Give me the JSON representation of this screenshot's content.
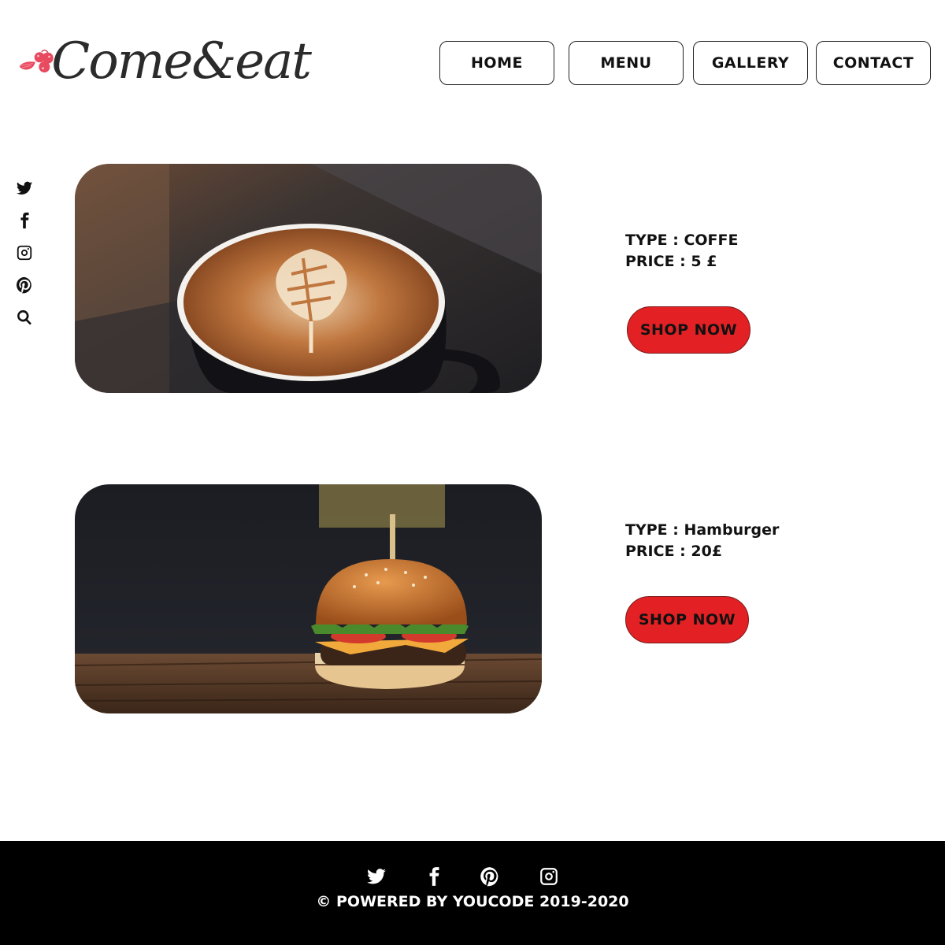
{
  "brand": {
    "name": "Come&eat",
    "accent": "#e84a5f"
  },
  "nav": {
    "home": "HOME",
    "menu": "MENU",
    "gallery": "GALLERY",
    "contact": "CONTACT"
  },
  "side_social": [
    "twitter-icon",
    "facebook-icon",
    "instagram-icon",
    "pinterest-icon",
    "search-icon"
  ],
  "products": [
    {
      "type_line": "TYPE : COFFE",
      "price_line": "PRICE : 5 £",
      "button": "SHOP NOW"
    },
    {
      "type_line": "TYPE : Hamburger",
      "price_line": "PRICE : 20£",
      "button": "SHOP NOW"
    }
  ],
  "footer": {
    "social": [
      "twitter-icon",
      "facebook-icon",
      "pinterest-icon",
      "instagram-icon"
    ],
    "copyright": "© POWERED BY YOUCODE 2019-2020"
  },
  "colors": {
    "shop_button": "#e32124",
    "footer_bg": "#000000"
  }
}
